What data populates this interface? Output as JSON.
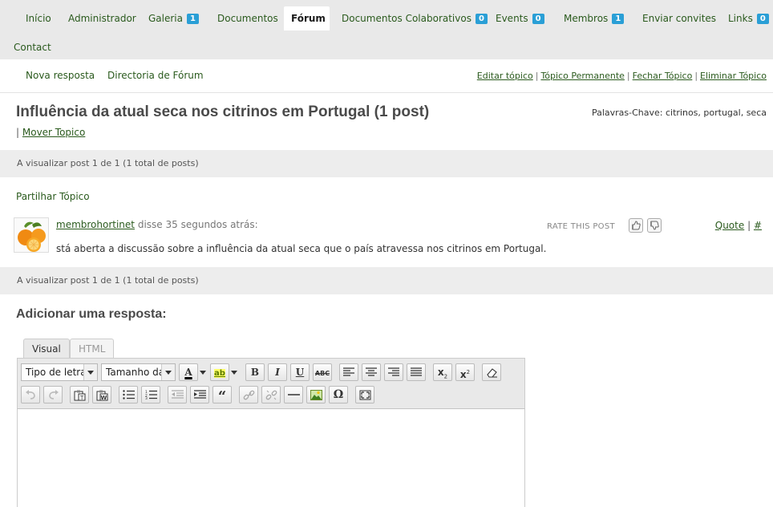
{
  "nav": {
    "items": [
      {
        "label": "Início",
        "badge": null
      },
      {
        "label": "Administrador",
        "badge": null
      },
      {
        "label": "Galeria",
        "badge": "1"
      },
      {
        "label": "Documentos",
        "badge": null
      },
      {
        "label": "Fórum",
        "badge": null,
        "active": true
      },
      {
        "label": "Documentos Colaborativos",
        "badge": "0"
      },
      {
        "label": "Events",
        "badge": "0"
      },
      {
        "label": "Membros",
        "badge": "1"
      },
      {
        "label": "Enviar convites",
        "badge": null
      },
      {
        "label": "Links",
        "badge": "0"
      },
      {
        "label": "Contact",
        "badge": null
      }
    ]
  },
  "subnav": {
    "new_reply": "Nova resposta",
    "forum_directory": "Directoria de Fórum",
    "admin_links": [
      "Editar tópico",
      "Tópico Permanente",
      "Fechar Tópico",
      "Eliminar Tópico"
    ],
    "separator": "|"
  },
  "topic": {
    "title": "Influência da atual seca nos citrinos em Portugal (1 post)",
    "move_prefix": "|",
    "move_label": "Mover Topico",
    "tags_label": "Palavras-Chave:",
    "tags": "citrinos, portugal, seca"
  },
  "pagination": {
    "text": "A visualizar post 1 de 1 (1 total de posts)"
  },
  "share_label": "Partilhar Tópico",
  "post": {
    "author": "membrohortinet",
    "said": "disse 35 segundos atrás:",
    "body": "stá aberta a discussão sobre a influência da atual seca que o país atravessa nos citrinos em Portugal.",
    "rate_label": "RATE THIS POST",
    "quote_label": "Quote",
    "permalink_label": "#",
    "actions_sep": "|"
  },
  "reply": {
    "title": "Adicionar uma resposta:",
    "tabs": {
      "visual": "Visual",
      "html": "HTML"
    },
    "toolbar": {
      "font_family": "Tipo de letra",
      "font_size": "Tamanho da letra",
      "icons": [
        "forecolor-icon",
        "highlight-icon",
        "bold-icon",
        "italic-icon",
        "underline-icon",
        "strikethrough-icon",
        "align-left-icon",
        "align-center-icon",
        "align-right-icon",
        "justify-icon",
        "subscript-icon",
        "superscript-icon",
        "eraser-icon",
        "undo-icon",
        "redo-icon",
        "paste-text-icon",
        "paste-word-icon",
        "bullet-list-icon",
        "numbered-list-icon",
        "outdent-icon",
        "indent-icon",
        "blockquote-icon",
        "link-icon",
        "unlink-icon",
        "horizontal-rule-icon",
        "image-icon",
        "special-char-icon",
        "fullscreen-icon"
      ]
    }
  },
  "colors": {
    "link_green": "#2a5a1d",
    "badge_blue": "#2a9fd6",
    "nav_bg": "#e9e9e9",
    "bar_bg": "#ededed"
  }
}
